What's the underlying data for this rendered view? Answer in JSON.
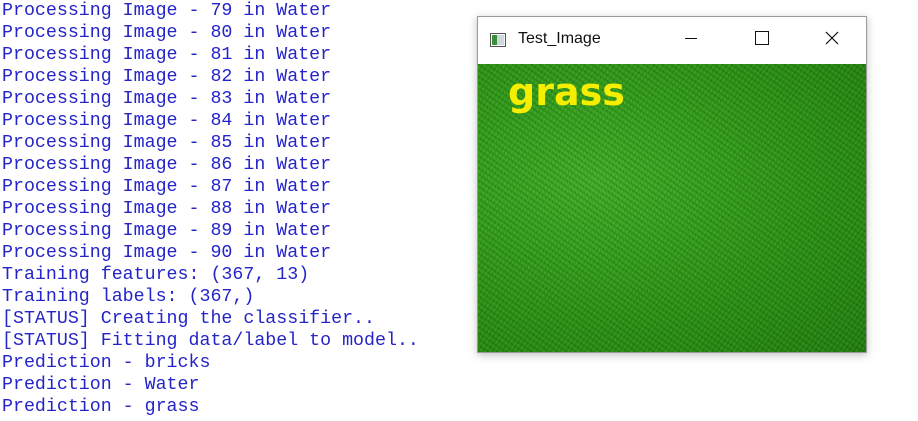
{
  "console": {
    "lines": [
      "Processing Image - 79 in Water",
      "Processing Image - 80 in Water",
      "Processing Image - 81 in Water",
      "Processing Image - 82 in Water",
      "Processing Image - 83 in Water",
      "Processing Image - 84 in Water",
      "Processing Image - 85 in Water",
      "Processing Image - 86 in Water",
      "Processing Image - 87 in Water",
      "Processing Image - 88 in Water",
      "Processing Image - 89 in Water",
      "Processing Image - 90 in Water",
      "Training features: (367, 13)",
      "Training labels: (367,)",
      "[STATUS] Creating the classifier..",
      "[STATUS] Fitting data/label to model..",
      "Prediction - bricks",
      "Prediction - Water",
      "Prediction - grass"
    ],
    "text_color": "#2424c8"
  },
  "window": {
    "title": "Test_Image",
    "app_icon": "window-app-icon",
    "controls": {
      "minimize_icon": "minimize-icon",
      "maximize_icon": "maximize-icon",
      "close_icon": "close-icon"
    },
    "image": {
      "label": "grass",
      "label_color": "#f6ee00",
      "content": "grass-texture"
    }
  }
}
